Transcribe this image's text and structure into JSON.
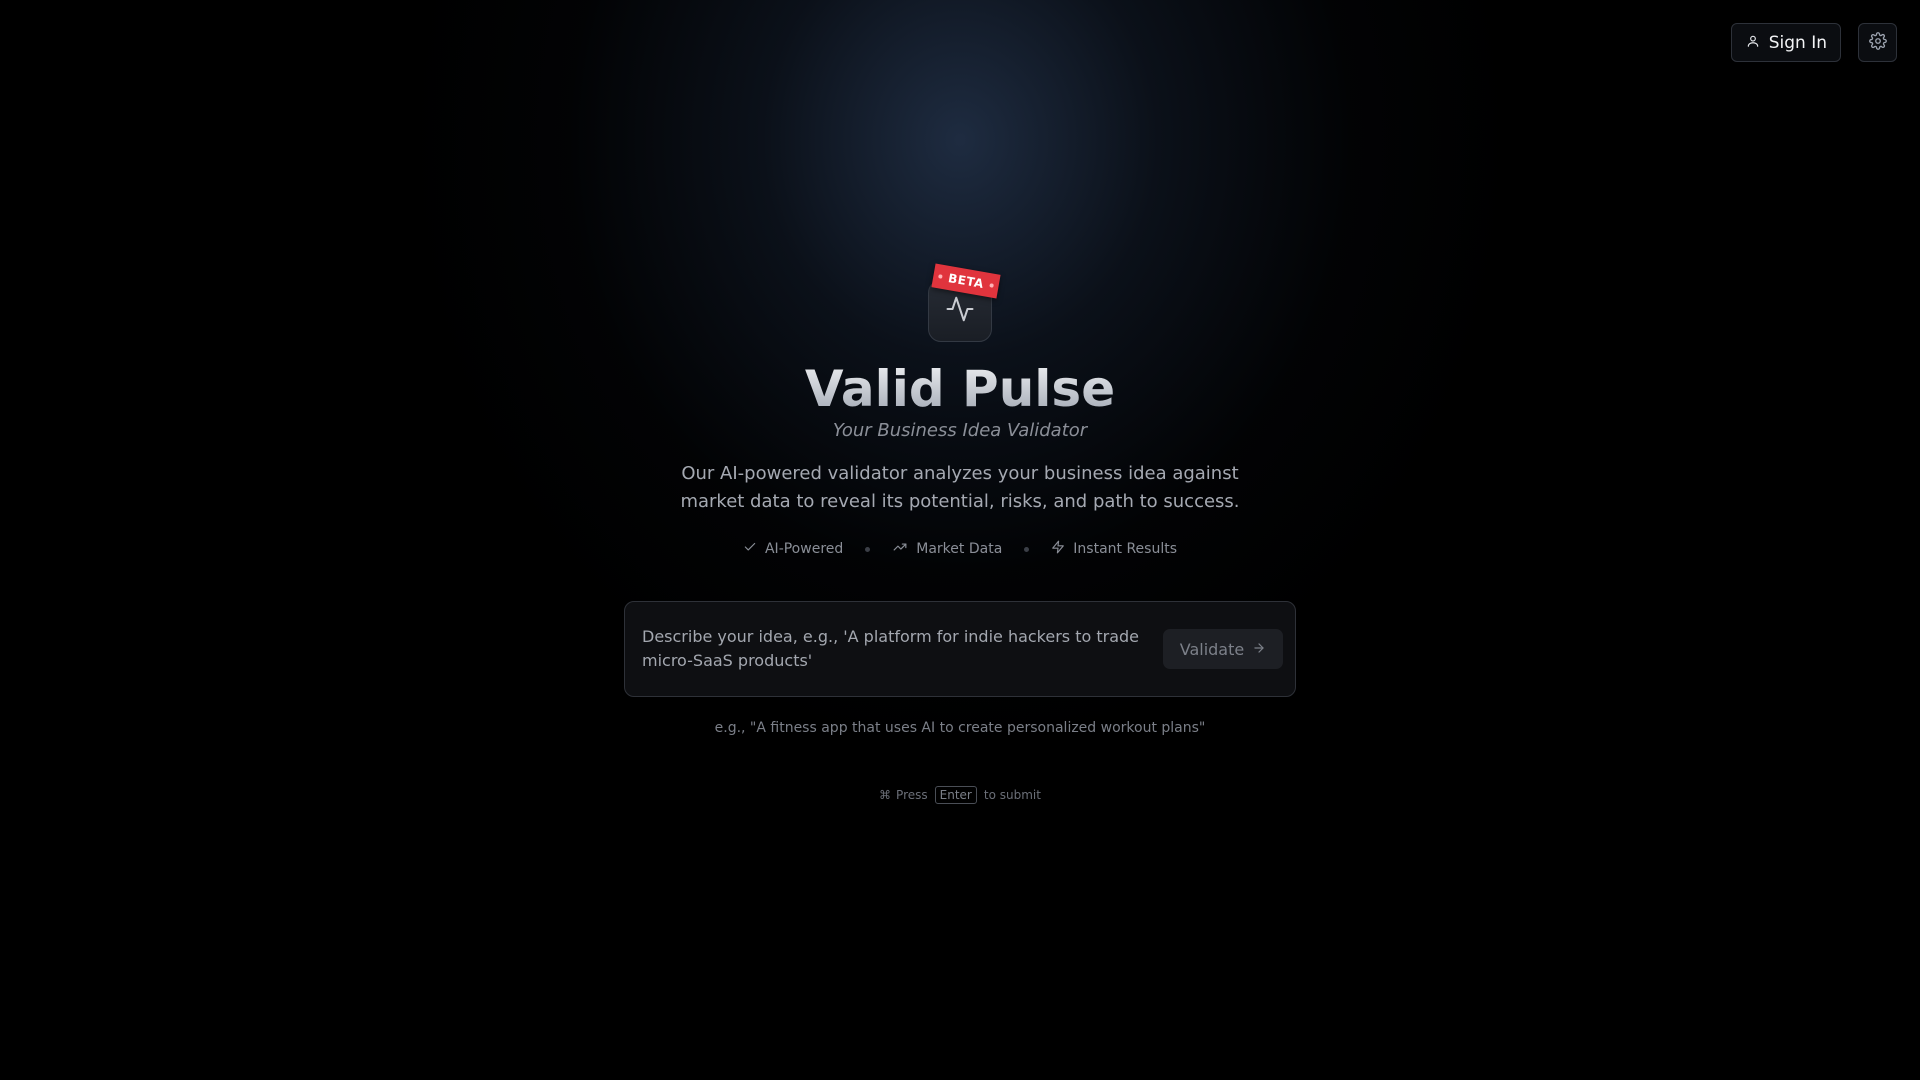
{
  "header": {
    "sign_in_label": "Sign In",
    "icons": {
      "user": "user-icon",
      "settings": "gear-icon"
    }
  },
  "logo": {
    "badge": "BETA",
    "icon": "activity-pulse-icon",
    "badge_color": "#e0343d"
  },
  "hero": {
    "title": "Valid Pulse",
    "subtitle": "Your Business Idea Validator",
    "description": "Our AI-powered validator analyzes your business idea against market data to reveal its potential, risks, and path to success."
  },
  "features": [
    {
      "label": "AI-Powered",
      "icon": "check-icon"
    },
    {
      "label": "Market Data",
      "icon": "trending-up-icon"
    },
    {
      "label": "Instant Results",
      "icon": "zap-icon"
    }
  ],
  "input": {
    "placeholder": "Describe your idea, e.g., 'A platform for indie hackers to trade micro-SaaS products'",
    "value": "",
    "button_label": "Validate"
  },
  "example_text": "e.g., \"A fitness app that uses AI to create personalized workout plans\"",
  "hint": {
    "press": "Press",
    "key": "Enter",
    "suffix": "to submit",
    "icon": "command-icon"
  }
}
